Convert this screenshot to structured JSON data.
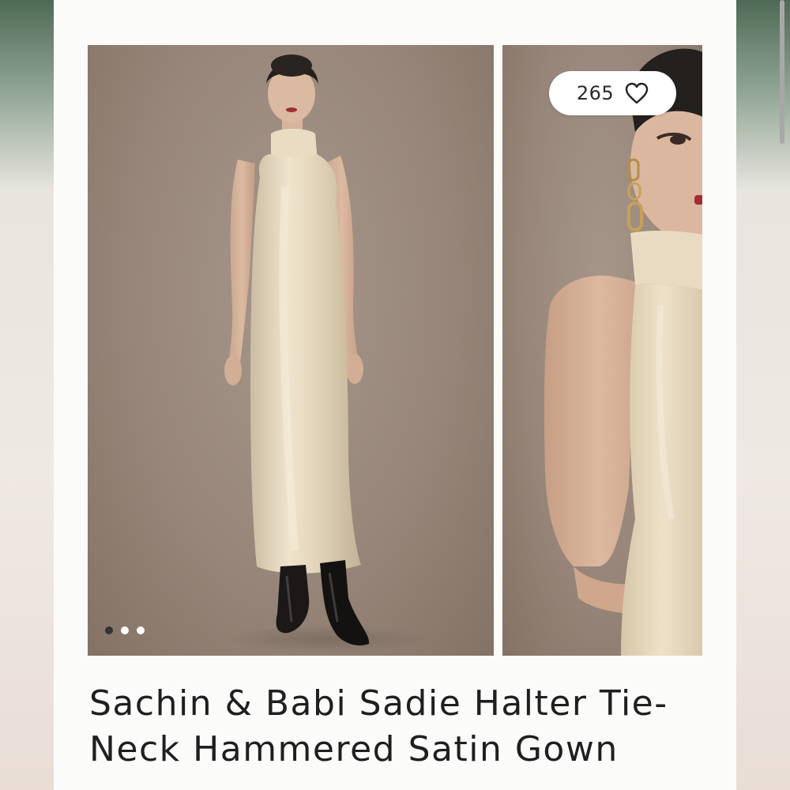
{
  "listing": {
    "title": "Sachin & Babi Sadie Halter Tie-Neck Hammered Satin Gown",
    "likes": "265",
    "like_icon": "heart-outline-icon",
    "carousel": {
      "total": 3,
      "active_index": 1
    }
  },
  "colors": {
    "backdrop": "#978679",
    "dress": "#e4d7bf",
    "page_background": "#fbfbfa",
    "title_text": "#1f1f1f"
  }
}
